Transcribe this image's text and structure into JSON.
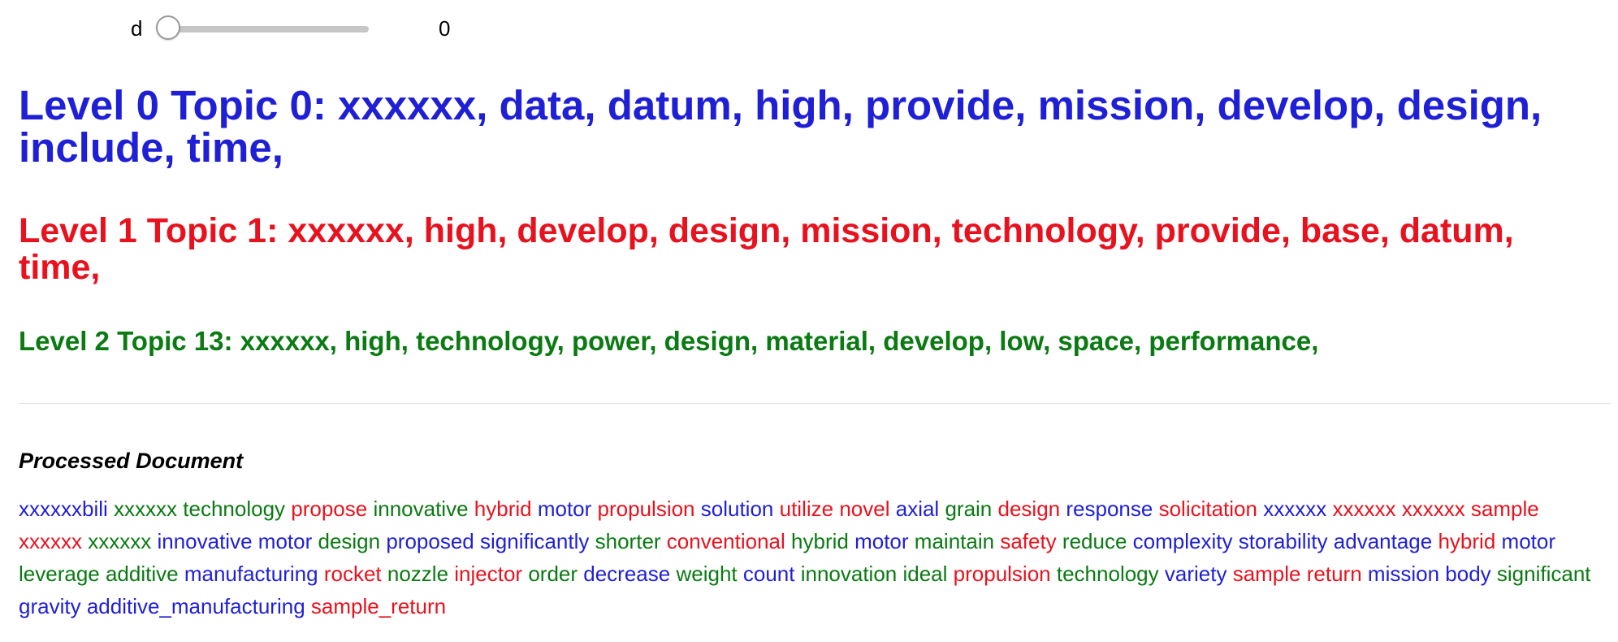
{
  "slider": {
    "label": "d",
    "value": "0",
    "fraction": 0
  },
  "topics": [
    {
      "text": "Level 0 Topic 0: xxxxxx, data, datum, high, provide, mission, develop, design, include, time,",
      "color": "#1f1fd6"
    },
    {
      "text": "Level 1 Topic 1: xxxxxx, high, develop, design, mission, technology, provide, base, datum, time,",
      "color": "#e8121e"
    },
    {
      "text": "Level 2 Topic 13: xxxxxx, high, technology, power, design, material, develop, low, space, performance,",
      "color": "#0a7a12"
    }
  ],
  "document": {
    "title": "Processed Document",
    "colors": {
      "blue": "#1f1fd6",
      "red": "#e8121e",
      "green": "#0a7a12"
    },
    "words": [
      {
        "w": "xxxxxxbili",
        "c": "blue"
      },
      {
        "w": "xxxxxx",
        "c": "green"
      },
      {
        "w": "technology",
        "c": "green"
      },
      {
        "w": "propose",
        "c": "red"
      },
      {
        "w": "innovative",
        "c": "green"
      },
      {
        "w": "hybrid",
        "c": "red"
      },
      {
        "w": "motor",
        "c": "blue"
      },
      {
        "w": "propulsion",
        "c": "red"
      },
      {
        "w": "solution",
        "c": "blue"
      },
      {
        "w": "utilize",
        "c": "red"
      },
      {
        "w": "novel",
        "c": "red"
      },
      {
        "w": "axial",
        "c": "blue"
      },
      {
        "w": "grain",
        "c": "green"
      },
      {
        "w": "design",
        "c": "red"
      },
      {
        "w": "response",
        "c": "blue"
      },
      {
        "w": "solicitation",
        "c": "red"
      },
      {
        "w": "xxxxxx",
        "c": "blue"
      },
      {
        "w": "xxxxxx",
        "c": "red"
      },
      {
        "w": "xxxxxx",
        "c": "red"
      },
      {
        "w": "sample",
        "c": "red"
      },
      {
        "w": "xxxxxx",
        "c": "red"
      },
      {
        "w": "xxxxxx",
        "c": "green"
      },
      {
        "w": "innovative",
        "c": "blue"
      },
      {
        "w": "motor",
        "c": "blue"
      },
      {
        "w": "design",
        "c": "green"
      },
      {
        "w": "proposed",
        "c": "blue"
      },
      {
        "w": "significantly",
        "c": "blue"
      },
      {
        "w": "shorter",
        "c": "green"
      },
      {
        "w": "conventional",
        "c": "red"
      },
      {
        "w": "hybrid",
        "c": "green"
      },
      {
        "w": "motor",
        "c": "blue"
      },
      {
        "w": "maintain",
        "c": "green"
      },
      {
        "w": "safety",
        "c": "red"
      },
      {
        "w": "reduce",
        "c": "green"
      },
      {
        "w": "complexity",
        "c": "blue"
      },
      {
        "w": "storability",
        "c": "blue"
      },
      {
        "w": "advantage",
        "c": "blue"
      },
      {
        "w": "hybrid",
        "c": "red"
      },
      {
        "w": "motor",
        "c": "blue"
      },
      {
        "w": "leverage",
        "c": "green"
      },
      {
        "w": "additive",
        "c": "green"
      },
      {
        "w": "manufacturing",
        "c": "blue"
      },
      {
        "w": "rocket",
        "c": "red"
      },
      {
        "w": "nozzle",
        "c": "green"
      },
      {
        "w": "injector",
        "c": "red"
      },
      {
        "w": "order",
        "c": "green"
      },
      {
        "w": "decrease",
        "c": "blue"
      },
      {
        "w": "weight",
        "c": "green"
      },
      {
        "w": "count",
        "c": "blue"
      },
      {
        "w": "innovation",
        "c": "green"
      },
      {
        "w": "ideal",
        "c": "green"
      },
      {
        "w": "propulsion",
        "c": "red"
      },
      {
        "w": "technology",
        "c": "green"
      },
      {
        "w": "variety",
        "c": "blue"
      },
      {
        "w": "sample",
        "c": "red"
      },
      {
        "w": "return",
        "c": "red"
      },
      {
        "w": "mission",
        "c": "blue"
      },
      {
        "w": "body",
        "c": "blue"
      },
      {
        "w": "significant",
        "c": "green"
      },
      {
        "w": "gravity",
        "c": "blue"
      },
      {
        "w": "additive_manufacturing",
        "c": "blue"
      },
      {
        "w": "sample_return",
        "c": "red"
      }
    ]
  }
}
